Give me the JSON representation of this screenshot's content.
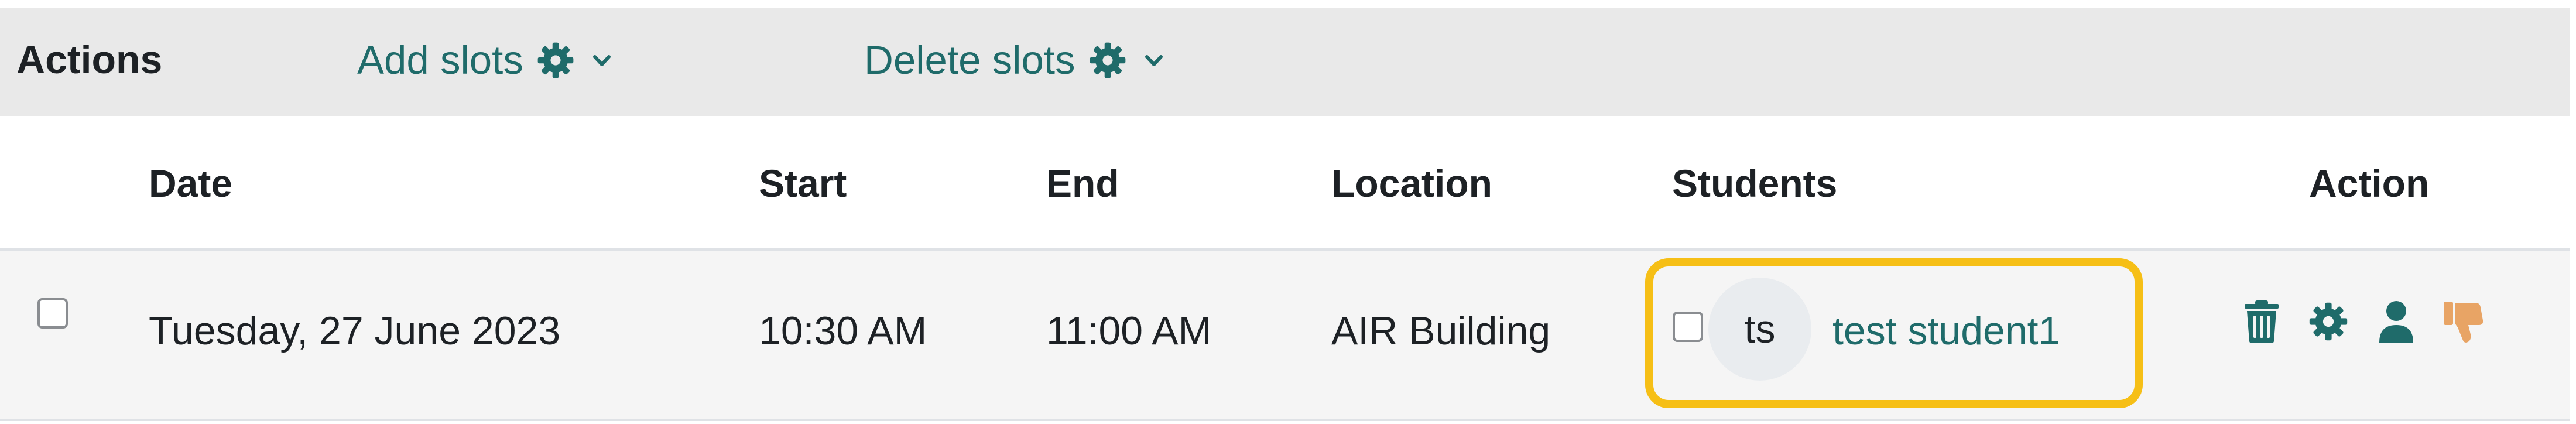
{
  "actions_bar": {
    "title": "Actions",
    "add_slots_label": "Add slots",
    "delete_slots_label": "Delete slots"
  },
  "table": {
    "headers": {
      "date": "Date",
      "start": "Start",
      "end": "End",
      "location": "Location",
      "students": "Students",
      "action": "Action"
    },
    "rows": [
      {
        "date": "Tuesday, 27 June 2023",
        "start": "10:30 AM",
        "end": "11:00 AM",
        "location": "AIR Building",
        "student_initials": "ts",
        "student_name": "test student1"
      }
    ]
  },
  "icons": {
    "menu_icons": [
      "gear-icon",
      "chevron-down-icon"
    ],
    "row_actions": [
      "trash-icon",
      "gear-icon",
      "user-icon",
      "thumbs-down-icon"
    ]
  },
  "colors": {
    "link": "#1f6b6a",
    "highlight": "#f6bf16",
    "thumb": "#e8a465",
    "bar_background": "#e9e9e9"
  }
}
